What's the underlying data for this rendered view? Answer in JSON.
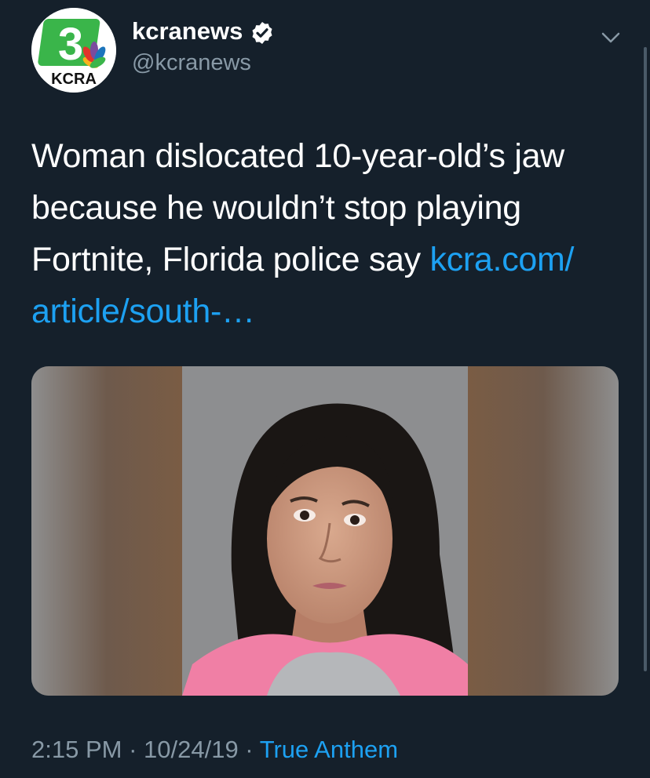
{
  "account": {
    "display_name": "kcranews",
    "handle": "@kcranews",
    "logo_number": "3",
    "logo_text": "KCRA"
  },
  "tweet": {
    "text": "Woman dislocated 10-year-old’s jaw because he wouldn’t stop playing Fortnite, Florida police say ",
    "link": "kcra.com/ article/south-…"
  },
  "meta": {
    "time": "2:15 PM",
    "separator": " · ",
    "date": "10/24/19",
    "source": "True Anthem"
  },
  "colors": {
    "background": "#15202b",
    "link": "#1da1f2",
    "secondary": "#8899a6",
    "logo_green": "#3ab54a"
  },
  "icons": [
    "kcra-logo",
    "verified-badge-icon",
    "chevron-down-icon"
  ]
}
